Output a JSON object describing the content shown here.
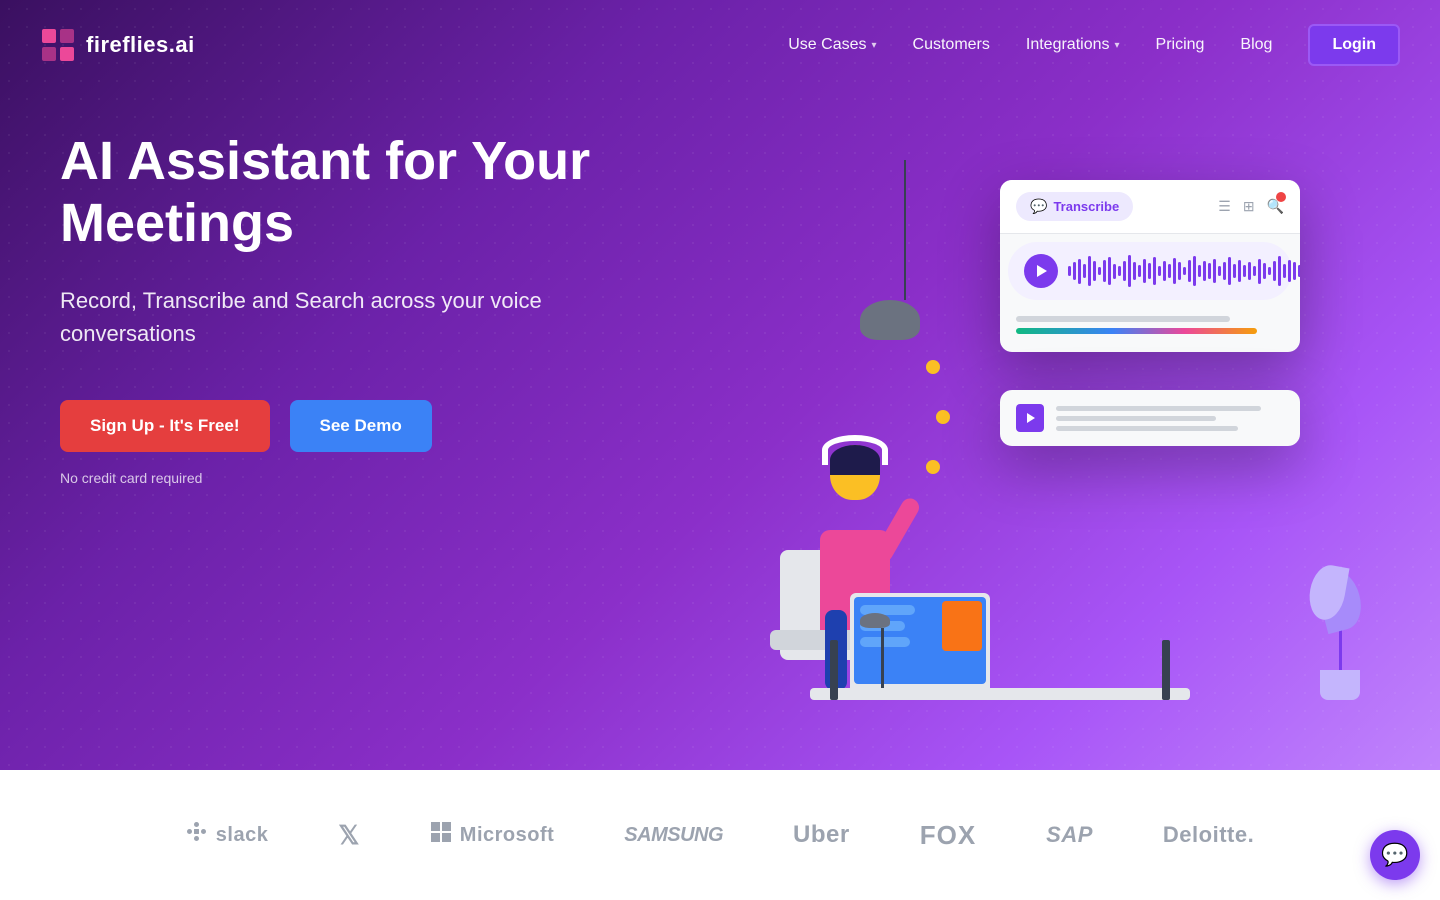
{
  "logo": {
    "text": "fireflies.ai",
    "icon_color": "#ec4899"
  },
  "nav": {
    "use_cases_label": "Use Cases",
    "customers_label": "Customers",
    "integrations_label": "Integrations",
    "pricing_label": "Pricing",
    "blog_label": "Blog",
    "login_label": "Login"
  },
  "hero": {
    "title": "AI Assistant for Your Meetings",
    "subtitle": "Record, Transcribe and Search across your voice conversations",
    "signup_label": "Sign Up - It's Free!",
    "demo_label": "See Demo",
    "no_cc_label": "No credit card required"
  },
  "transcription_card": {
    "transcribe_label": "Transcribe"
  },
  "brands": [
    {
      "name": "slack",
      "label": "slack",
      "icon": "⊞"
    },
    {
      "name": "twitter",
      "label": "",
      "icon": "🐦"
    },
    {
      "name": "microsoft",
      "label": "Microsoft",
      "icon": "⊞"
    },
    {
      "name": "samsung",
      "label": "SAMSUNG",
      "icon": ""
    },
    {
      "name": "uber",
      "label": "Uber",
      "icon": ""
    },
    {
      "name": "fox",
      "label": "FOX",
      "icon": ""
    },
    {
      "name": "sap",
      "label": "SAP",
      "icon": ""
    },
    {
      "name": "deloitte",
      "label": "Deloitte.",
      "icon": ""
    }
  ],
  "colors": {
    "primary_purple": "#7c3aed",
    "hero_bg_start": "#3a1060",
    "hero_bg_end": "#a855f7",
    "signup_btn": "#e53e3e",
    "demo_btn": "#3b82f6",
    "login_btn": "#7c3aed"
  }
}
